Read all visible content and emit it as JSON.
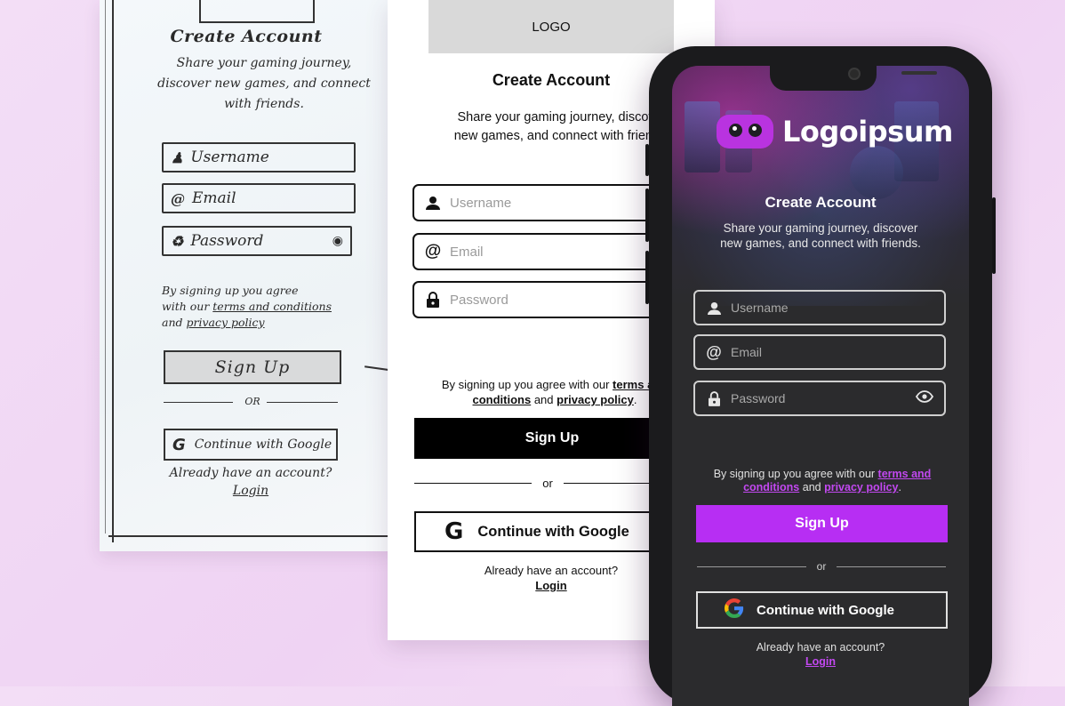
{
  "sketch": {
    "title": "Create Account",
    "subtitle_1": "Share your gaming journey,",
    "subtitle_2": "discover new games, and connect",
    "subtitle_3": "with friends.",
    "username": "Username",
    "email": "Email",
    "password": "Password",
    "terms_1": "By signing up you agree",
    "terms_2a": "with our ",
    "terms_2b": "terms and conditions",
    "terms_3a": "and ",
    "terms_3b": "privacy policy",
    "signup": "Sign Up",
    "or": "OR",
    "google": "Continue with Google",
    "already": "Already have an account?",
    "login": "Login"
  },
  "wireframe": {
    "logo": "LOGO",
    "title": "Create Account",
    "subtitle": "Share your gaming journey, discover\nnew games, and connect with friends.",
    "username_placeholder": "Username",
    "email_placeholder": "Email",
    "password_placeholder": "Password",
    "terms_prefix": "By signing up you agree with our ",
    "terms_link": "terms and conditions",
    "terms_mid": " and ",
    "privacy_link": "privacy policy",
    "terms_suffix": ".",
    "signup": "Sign Up",
    "or": "or",
    "google": "Continue with Google",
    "already": "Already have an account?",
    "login": "Login"
  },
  "phone": {
    "brand": "Logoipsum",
    "title": "Create Account",
    "subtitle": "Share your gaming journey, discover\nnew games, and connect with friends.",
    "username_placeholder": "Username",
    "email_placeholder": "Email",
    "password_placeholder": "Password",
    "terms_prefix": "By signing up you agree with our ",
    "terms_link": "terms and conditions",
    "terms_mid": " and ",
    "privacy_link": "privacy policy",
    "terms_suffix": ".",
    "signup": "Sign Up",
    "or": "or",
    "google": "Continue with Google",
    "already": "Already have an account?",
    "login": "Login",
    "accent_color": "#b72ef3"
  }
}
